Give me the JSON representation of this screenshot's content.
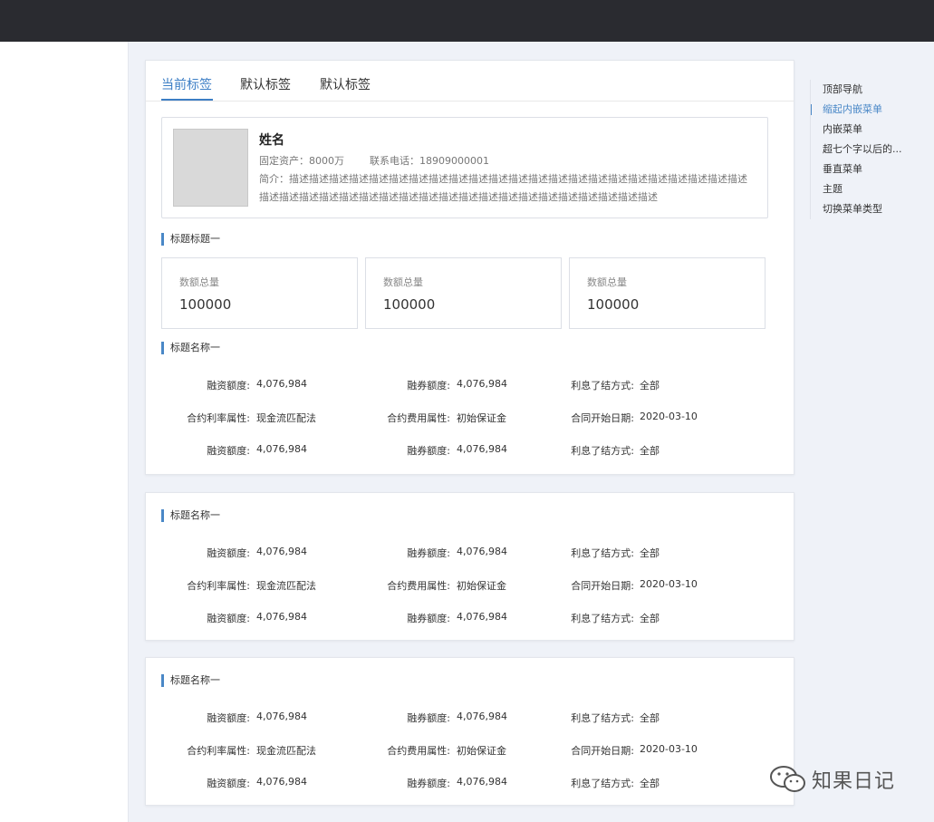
{
  "tabs": [
    "当前标签",
    "默认标签",
    "默认标签"
  ],
  "profile": {
    "name": "姓名",
    "assets": "固定资产：8000万",
    "phone": "联系电话：18909000001",
    "description": "简介：描述描述描述描述描述描述描述描述描述描述描述描述描述描述描述描述描述描述描述描述描述描述描述描述描述描述描述描述描述描述描述描述描述描述描述描述描述描述描述描述描述描述描述"
  },
  "card1": {
    "section1_title": "标题标题一",
    "stats": [
      {
        "label": "数额总量",
        "value": "100000"
      },
      {
        "label": "数额总量",
        "value": "100000"
      },
      {
        "label": "数额总量",
        "value": "100000"
      }
    ],
    "section2_title": "标题名称一"
  },
  "detail_rows": [
    [
      {
        "k": "融资额度:",
        "v": "4,076,984"
      },
      {
        "k": "融券额度:",
        "v": "4,076,984"
      },
      {
        "k": "利息了结方式:",
        "v": "全部"
      }
    ],
    [
      {
        "k": "合约利率属性:",
        "v": "现金流匹配法"
      },
      {
        "k": "合约费用属性:",
        "v": "初始保证金"
      },
      {
        "k": "合同开始日期:",
        "v": "2020-03-10"
      }
    ],
    [
      {
        "k": "融资额度:",
        "v": "4,076,984"
      },
      {
        "k": "融券额度:",
        "v": "4,076,984"
      },
      {
        "k": "利息了结方式:",
        "v": "全部"
      }
    ]
  ],
  "card2": {
    "title": "标题名称一"
  },
  "card3": {
    "title": "标题名称一"
  },
  "anchor": {
    "items": [
      "顶部导航",
      "缩起内嵌菜单",
      "内嵌菜单",
      "超七个字以后的...",
      "垂直菜单",
      "主题",
      "切换菜单类型"
    ],
    "active_index": 1
  },
  "watermark": {
    "text": "知果日记",
    "icon": "wechat-icon"
  },
  "colors": {
    "accent": "#3c7ec5",
    "topbar": "#2a2b30",
    "content_bg": "#eff2f8"
  }
}
